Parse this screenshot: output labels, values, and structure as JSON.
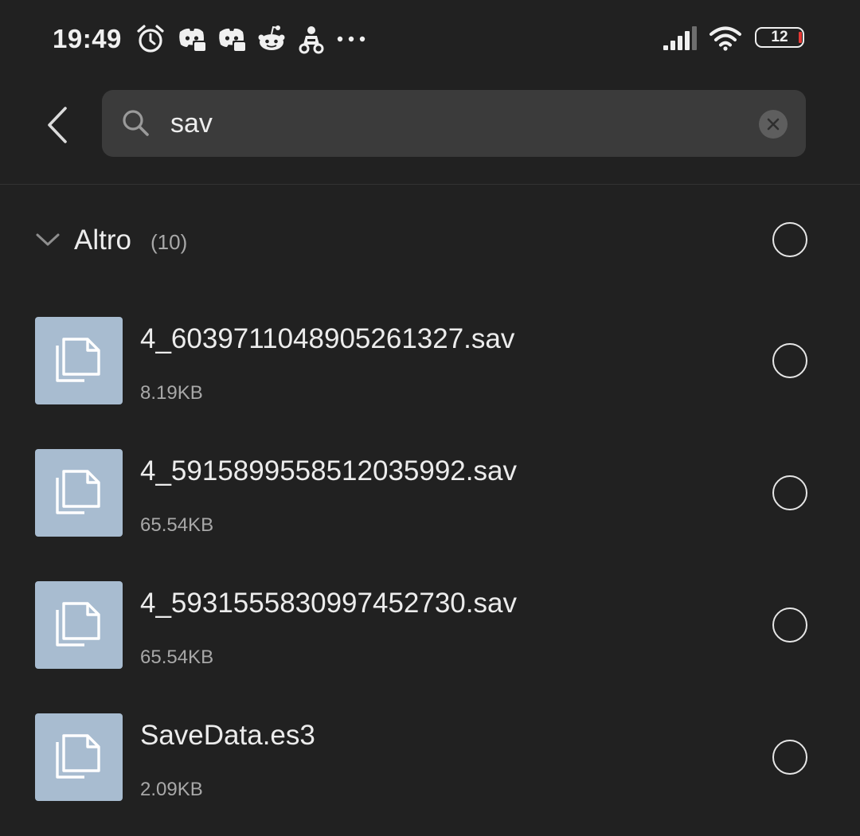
{
  "status_bar": {
    "time": "19:49",
    "notification_icons": [
      "alarm-clock-icon",
      "discord-icon",
      "discord-icon",
      "reddit-icon",
      "game-app-icon",
      "more-dots-icon"
    ],
    "battery_level": "12"
  },
  "search": {
    "query": "sav",
    "placeholder": ""
  },
  "group": {
    "title": "Altro",
    "count": "(10)"
  },
  "files": [
    {
      "name": "4_6039711048905261327.sav",
      "size": "8.19KB"
    },
    {
      "name": "4_5915899558512035992.sav",
      "size": "65.54KB"
    },
    {
      "name": "4_5931555830997452730.sav",
      "size": "65.54KB"
    },
    {
      "name": "SaveData.es3",
      "size": "2.09KB"
    }
  ],
  "colors": {
    "background": "#212121",
    "search_bg": "#3b3b3b",
    "thumb_bg": "#a8bcd0",
    "battery_low": "#e53935"
  }
}
